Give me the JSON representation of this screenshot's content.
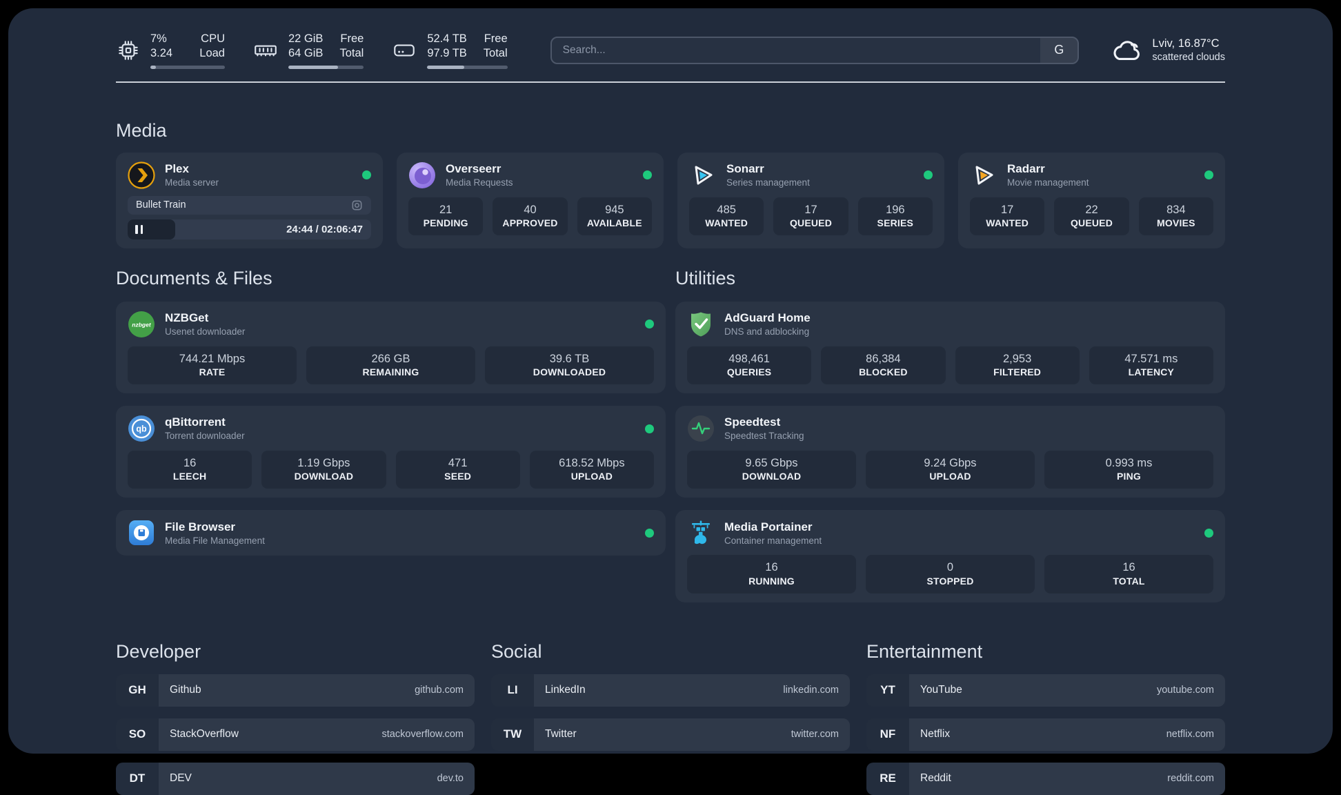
{
  "header": {
    "stats": [
      {
        "id": "cpu",
        "value_top": "7%",
        "value_bottom": "3.24",
        "label_top": "CPU",
        "label_bottom": "Load",
        "progress_pct": 7
      },
      {
        "id": "memory",
        "value_top": "22 GiB",
        "value_bottom": "64 GiB",
        "label_top": "Free",
        "label_bottom": "Total",
        "progress_pct": 66
      },
      {
        "id": "storage",
        "value_top": "52.4 TB",
        "value_bottom": "97.9 TB",
        "label_top": "Free",
        "label_bottom": "Total",
        "progress_pct": 46
      }
    ],
    "search": {
      "placeholder": "Search...",
      "provider_label": "G"
    },
    "weather": {
      "location_temp": "Lviv, 16.87°C",
      "condition": "scattered clouds"
    }
  },
  "sections": {
    "media": {
      "title": "Media",
      "cards": [
        {
          "name": "Plex",
          "subtitle": "Media server",
          "status": "online",
          "player": {
            "title": "Bullet Train",
            "state": "paused",
            "time_display": "24:44 / 02:06:47",
            "progress_pct": 19.5
          }
        },
        {
          "name": "Overseerr",
          "subtitle": "Media Requests",
          "status": "online",
          "stats": [
            {
              "value": "21",
              "label": "PENDING"
            },
            {
              "value": "40",
              "label": "APPROVED"
            },
            {
              "value": "945",
              "label": "AVAILABLE"
            }
          ]
        },
        {
          "name": "Sonarr",
          "subtitle": "Series management",
          "status": "online",
          "stats": [
            {
              "value": "485",
              "label": "WANTED"
            },
            {
              "value": "17",
              "label": "QUEUED"
            },
            {
              "value": "196",
              "label": "SERIES"
            }
          ]
        },
        {
          "name": "Radarr",
          "subtitle": "Movie management",
          "status": "online",
          "stats": [
            {
              "value": "17",
              "label": "WANTED"
            },
            {
              "value": "22",
              "label": "QUEUED"
            },
            {
              "value": "834",
              "label": "MOVIES"
            }
          ]
        }
      ]
    },
    "documents": {
      "title": "Documents & Files",
      "cards": [
        {
          "name": "NZBGet",
          "subtitle": "Usenet downloader",
          "status": "online",
          "stats": [
            {
              "value": "744.21 Mbps",
              "label": "RATE"
            },
            {
              "value": "266 GB",
              "label": "REMAINING"
            },
            {
              "value": "39.6 TB",
              "label": "DOWNLOADED"
            }
          ]
        },
        {
          "name": "qBittorrent",
          "subtitle": "Torrent downloader",
          "status": "online",
          "stats": [
            {
              "value": "16",
              "label": "LEECH"
            },
            {
              "value": "1.19 Gbps",
              "label": "DOWNLOAD"
            },
            {
              "value": "471",
              "label": "SEED"
            },
            {
              "value": "618.52 Mbps",
              "label": "UPLOAD"
            }
          ]
        },
        {
          "name": "File Browser",
          "subtitle": "Media File Management",
          "status": "online",
          "stats": []
        }
      ]
    },
    "utilities": {
      "title": "Utilities",
      "cards": [
        {
          "name": "AdGuard Home",
          "subtitle": "DNS and adblocking",
          "stats": [
            {
              "value": "498,461",
              "label": "QUERIES"
            },
            {
              "value": "86,384",
              "label": "BLOCKED"
            },
            {
              "value": "2,953",
              "label": "FILTERED"
            },
            {
              "value": "47.571 ms",
              "label": "LATENCY"
            }
          ]
        },
        {
          "name": "Speedtest",
          "subtitle": "Speedtest Tracking",
          "stats": [
            {
              "value": "9.65 Gbps",
              "label": "DOWNLOAD"
            },
            {
              "value": "9.24 Gbps",
              "label": "UPLOAD"
            },
            {
              "value": "0.993 ms",
              "label": "PING"
            }
          ]
        },
        {
          "name": "Media Portainer",
          "subtitle": "Container management",
          "status": "online",
          "stats": [
            {
              "value": "16",
              "label": "RUNNING"
            },
            {
              "value": "0",
              "label": "STOPPED"
            },
            {
              "value": "16",
              "label": "TOTAL"
            }
          ]
        }
      ]
    },
    "links": [
      {
        "title": "Developer",
        "items": [
          {
            "abbr": "GH",
            "name": "Github",
            "url": "github.com"
          },
          {
            "abbr": "SO",
            "name": "StackOverflow",
            "url": "stackoverflow.com"
          },
          {
            "abbr": "DT",
            "name": "DEV",
            "url": "dev.to"
          }
        ]
      },
      {
        "title": "Social",
        "items": [
          {
            "abbr": "LI",
            "name": "LinkedIn",
            "url": "linkedin.com"
          },
          {
            "abbr": "TW",
            "name": "Twitter",
            "url": "twitter.com"
          }
        ]
      },
      {
        "title": "Entertainment",
        "items": [
          {
            "abbr": "YT",
            "name": "YouTube",
            "url": "youtube.com"
          },
          {
            "abbr": "NF",
            "name": "Netflix",
            "url": "netflix.com"
          },
          {
            "abbr": "RE",
            "name": "Reddit",
            "url": "reddit.com"
          }
        ]
      }
    ]
  },
  "colors": {
    "status_online": "#1ec97d",
    "page_bg": "#212b3c",
    "card_bg": "#2a3444"
  }
}
